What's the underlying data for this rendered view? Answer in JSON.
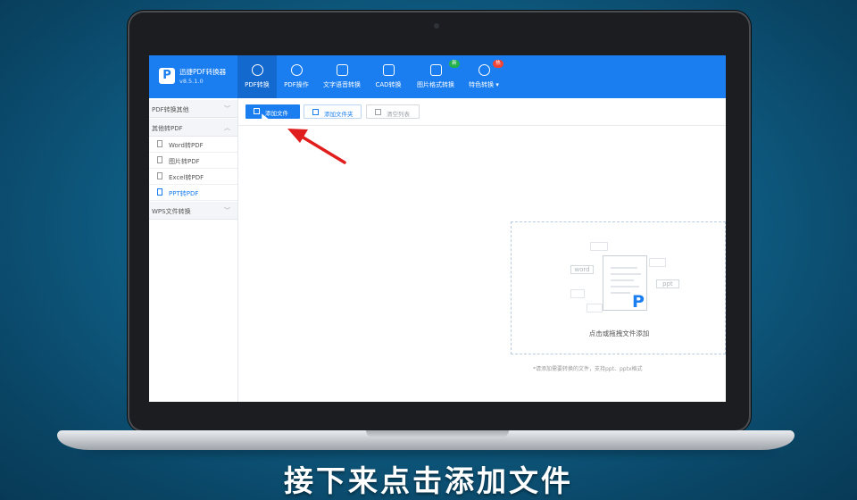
{
  "app": {
    "name": "迅捷PDF转换器",
    "version": "v8.5.1.0"
  },
  "nav": {
    "tabs": [
      {
        "label": "PDF转换",
        "icon": "pdf-convert-icon",
        "active": true
      },
      {
        "label": "PDF操作",
        "icon": "pdf-operation-icon"
      },
      {
        "label": "文字语音转换",
        "icon": "text-voice-icon"
      },
      {
        "label": "CAD转换",
        "icon": "cad-icon"
      },
      {
        "label": "图片格式转换",
        "icon": "image-icon",
        "badge": "新"
      },
      {
        "label": "特色转换 ▾",
        "icon": "feature-icon",
        "badge": "热"
      }
    ]
  },
  "sidebar": {
    "groups": [
      {
        "label": "PDF转换其他",
        "chevron": "﹀"
      },
      {
        "label": "其他转PDF",
        "chevron": "︿"
      },
      {
        "label": "WPS文件转换",
        "chevron": "﹀"
      }
    ],
    "items": [
      {
        "label": "Word转PDF"
      },
      {
        "label": "图片转PDF"
      },
      {
        "label": "Excel转PDF"
      },
      {
        "label": "PPT转PDF",
        "active": true
      }
    ]
  },
  "toolbar": {
    "add_file": "添加文件",
    "add_folder": "添加文件夹",
    "clear_list": "清空列表"
  },
  "dropzone": {
    "label": "点击或拖拽文件添加",
    "tags": {
      "word": "word",
      "ppt": "ppt"
    },
    "hint": "*请添加需要转换的文件，支持ppt、pptx格式"
  },
  "caption": "接下来点击添加文件",
  "colors": {
    "accent": "#1a7ef0",
    "badge_new": "#22b14c",
    "badge_hot": "#f04438",
    "annotation_arrow": "#e01e1e"
  }
}
